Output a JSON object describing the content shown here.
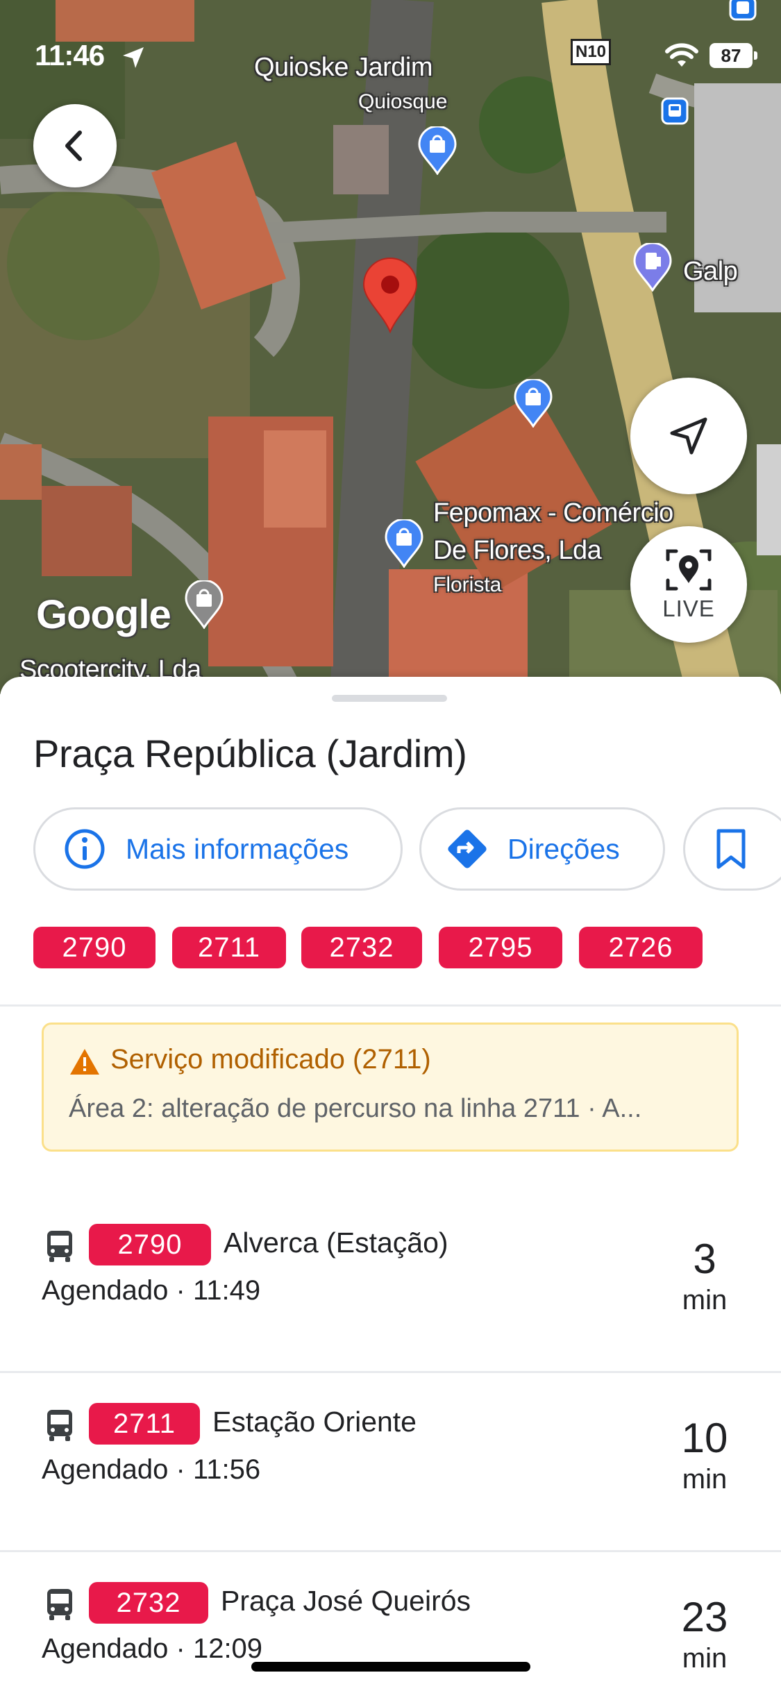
{
  "status_bar": {
    "time": "11:46",
    "road_badge": "N10",
    "battery": "87"
  },
  "map": {
    "labels": {
      "quioske_jardim": "Quioske Jardim",
      "quiosque": "Quiosque",
      "galp": "Galp",
      "fepomax_line1": "Fepomax - Comércio",
      "fepomax_line2": "De Flores, Lda",
      "florista": "Florista",
      "scootercity": "Scootercity, Lda"
    },
    "google_logo": "Google",
    "live_button": "LIVE",
    "icons": {
      "back": "back-arrow-icon",
      "navigate": "navigation-arrow-icon",
      "live": "live-view-icon",
      "marker": "location-marker-icon"
    }
  },
  "place": {
    "title": "Praça República (Jardim)",
    "actions": {
      "info": "Mais informações",
      "directions": "Direções"
    },
    "routes": [
      "2790",
      "2711",
      "2732",
      "2795",
      "2726"
    ]
  },
  "alert": {
    "title": "Serviço modificado (2711)",
    "body": "Área 2: alteração de percurso na linha 2711 · A..."
  },
  "departures": [
    {
      "route": "2790",
      "destination": "Alverca (Estação)",
      "scheduled": "Agendado · 11:49",
      "minutes": "3",
      "unit": "min"
    },
    {
      "route": "2711",
      "destination": "Estação Oriente",
      "scheduled": "Agendado · 11:56",
      "minutes": "10",
      "unit": "min"
    },
    {
      "route": "2732",
      "destination": "Praça José Queirós",
      "scheduled": "Agendado · 12:09",
      "minutes": "23",
      "unit": "min"
    }
  ],
  "colors": {
    "route_red": "#e8194a",
    "link_blue": "#1a73e8",
    "alert_bg": "#fef7e0",
    "alert_text": "#b06000"
  }
}
